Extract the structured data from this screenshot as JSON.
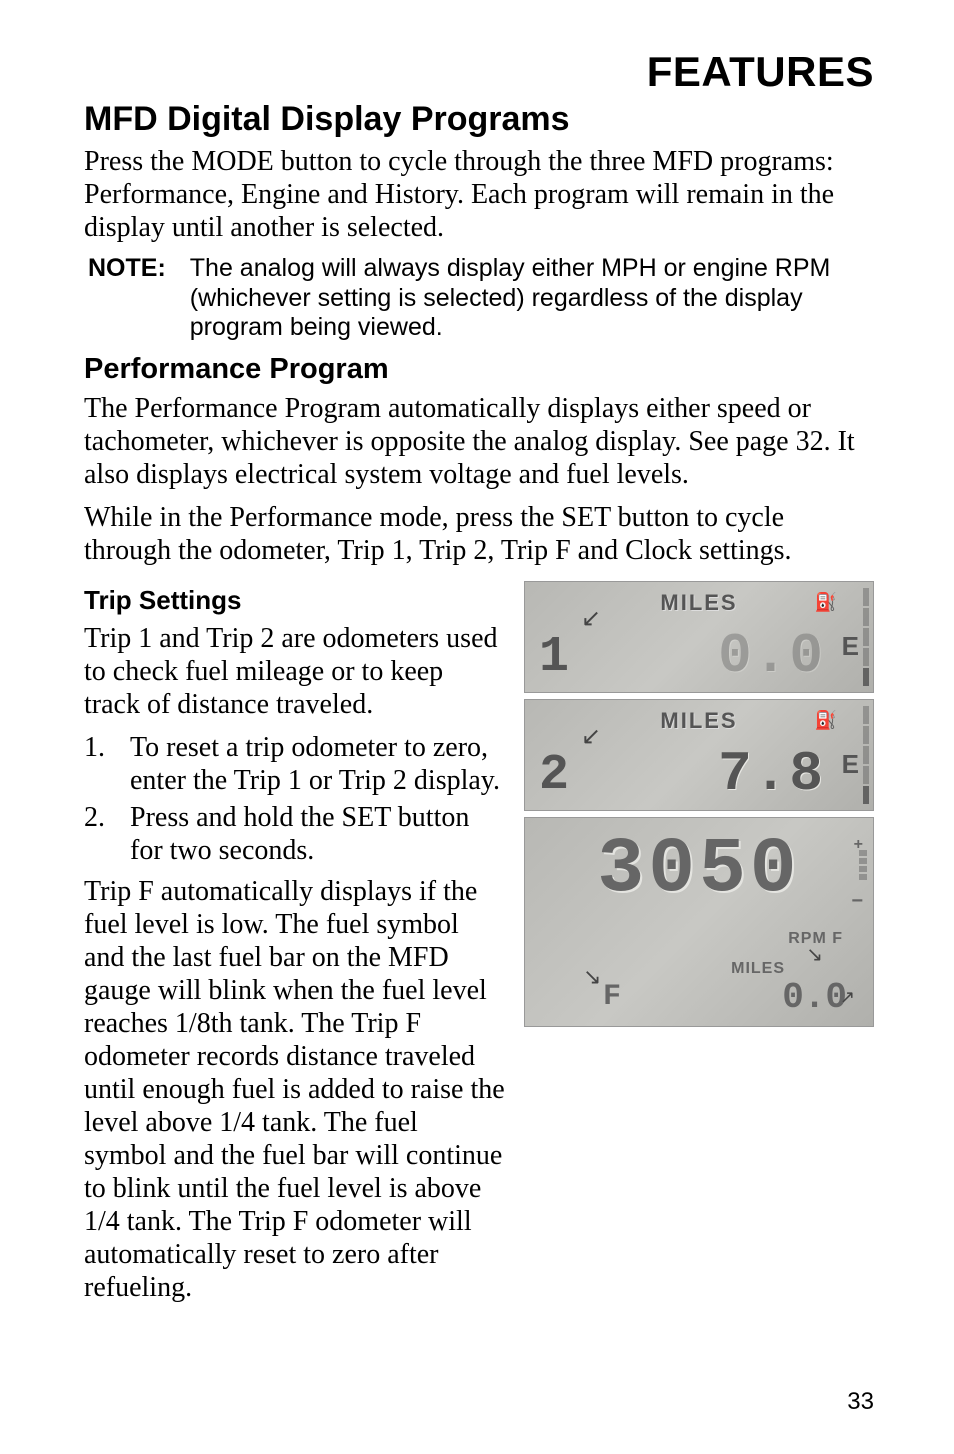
{
  "header": "FEATURES",
  "h1": "MFD Digital Display Programs",
  "intro": "Press the MODE button to cycle through the three MFD programs: Performance, Engine and History.  Each program will remain in the display until another is selected.",
  "note_label": "NOTE:",
  "note_text": "The analog will always display either MPH or engine RPM (whichever setting is selected) regardless of the display program being viewed.",
  "h2": "Performance Program",
  "perf_p1": "The Performance Program automatically displays either speed or tachometer, whichever is opposite the analog display.  See page 32.  It also displays electrical system voltage and fuel levels.",
  "perf_p2": "While in the Performance mode, press the SET button to cycle through the odometer, Trip 1, Trip 2, Trip F and Clock settings.",
  "h3": "Trip Settings",
  "trip_intro": "Trip 1 and Trip 2 are odometers used to check fuel mileage or to keep track of distance traveled.",
  "step1_num": "1.",
  "step1": "To reset a trip odometer to zero, enter the Trip 1 or Trip 2 display.",
  "step2_num": "2.",
  "step2": "Press and hold the SET button for two seconds.",
  "trip_f": "Trip F automatically displays if the fuel level is low. The fuel symbol and the last fuel bar on the MFD gauge will blink when the fuel level reaches 1/8th tank.  The Trip F odometer records distance traveled until enough fuel is added to raise the level above 1/4 tank.  The fuel symbol and the fuel bar will continue to blink until the fuel level is above 1/4 tank.  The Trip F odometer will automatically reset to zero after refueling.",
  "page_num": "33",
  "lcd1": {
    "miles": "MILES",
    "trip": "1",
    "value": "0.0",
    "e": "E"
  },
  "lcd2": {
    "miles": "MILES",
    "trip": "2",
    "value": "7.8",
    "e": "E"
  },
  "lcd3": {
    "rpm_val": "3050",
    "rpm_label": "RPM F",
    "miles": "MILES",
    "sub": "0.0",
    "f": "F"
  }
}
